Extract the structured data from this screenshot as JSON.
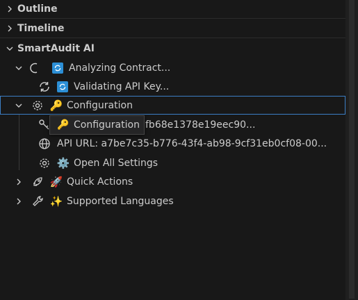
{
  "sections": {
    "outline": {
      "label": "Outline"
    },
    "timeline": {
      "label": "Timeline"
    },
    "smartaudit": {
      "label": "SmartAudit AI"
    }
  },
  "tree": {
    "analyzing": {
      "label": "Analyzing Contract..."
    },
    "validating": {
      "label": "Validating API Key..."
    },
    "configuration": {
      "label": "Configuration",
      "emoji": "🔑"
    },
    "api_key": {
      "label": "fb68e1378e19eec90..."
    },
    "api_url": {
      "label": "API URL: a7be7c35-b776-43f4-ab98-9cf31eb0cf08-00..."
    },
    "open_settings": {
      "label": "Open All Settings",
      "emoji": "⚙️"
    },
    "quick_actions": {
      "label": "Quick Actions",
      "emoji": "🚀"
    },
    "supported_languages": {
      "label": "Supported Languages",
      "emoji": "✨"
    }
  },
  "tooltip": {
    "label": "Configuration",
    "emoji": "🔑"
  },
  "colors": {
    "accent_border": "#3c7fc6",
    "sync_badge": "#2c8fd6"
  }
}
